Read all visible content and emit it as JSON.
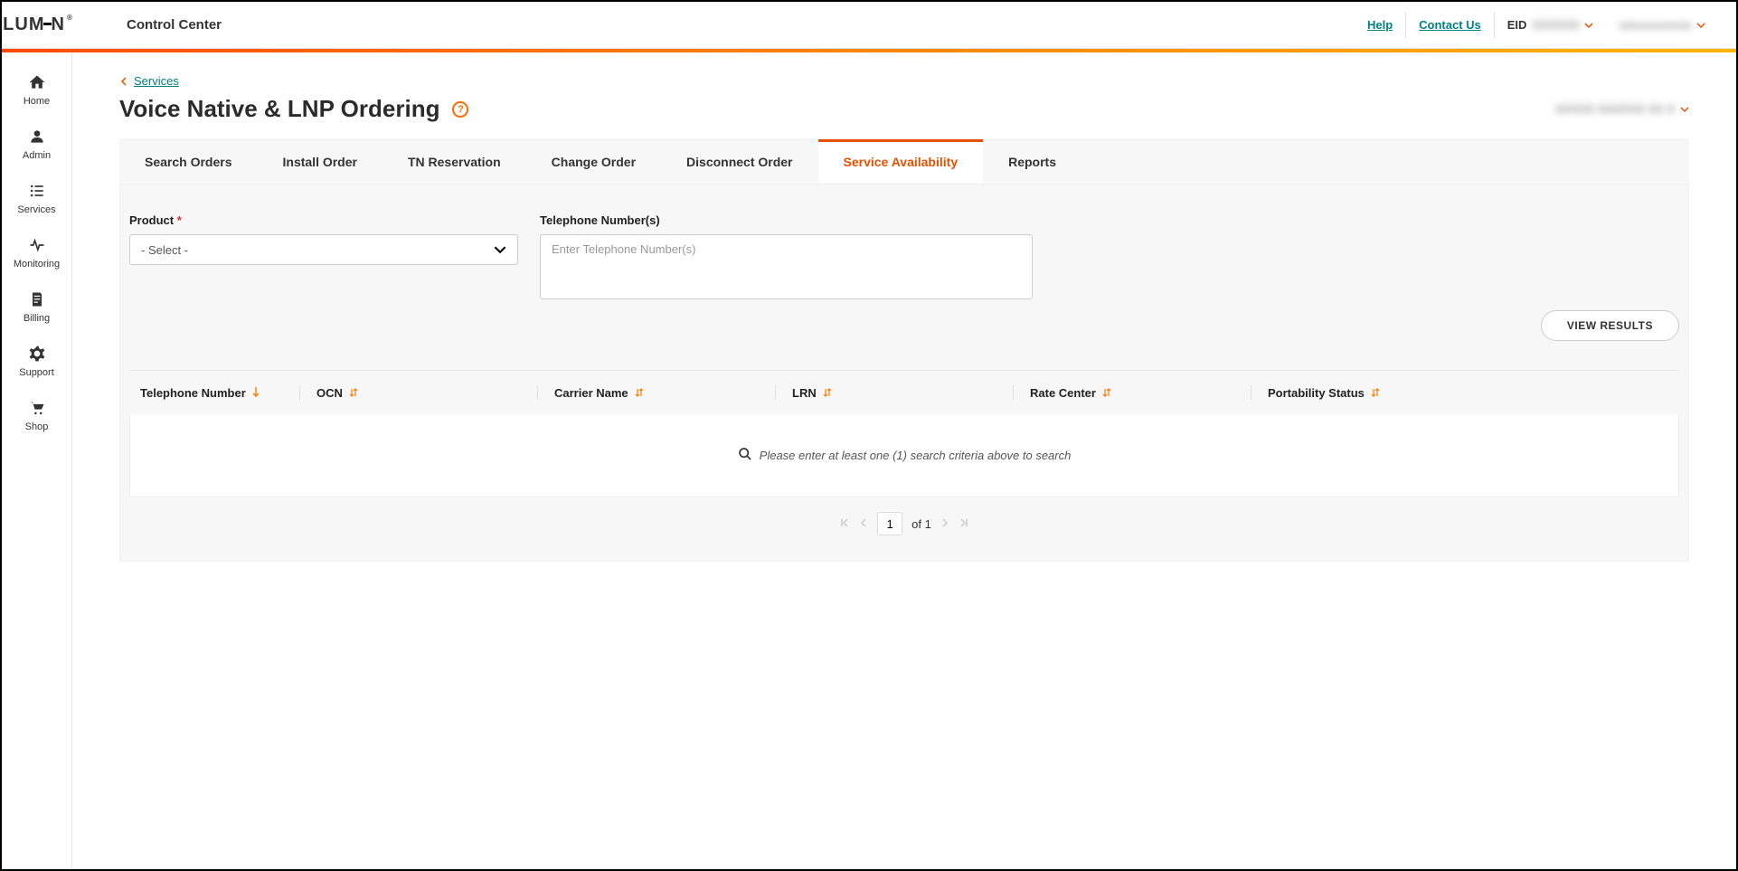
{
  "header": {
    "logo_text_left": "LUM",
    "logo_text_right": "N",
    "app_title": "Control Center",
    "help": "Help",
    "contact": "Contact Us",
    "eid_label": "EID",
    "eid_value": "XXXXXX",
    "user_name": "xxxxxxxxxxx"
  },
  "sidenav": {
    "items": [
      {
        "label": "Home"
      },
      {
        "label": "Admin"
      },
      {
        "label": "Services"
      },
      {
        "label": "Monitoring"
      },
      {
        "label": "Billing"
      },
      {
        "label": "Support"
      },
      {
        "label": "Shop"
      }
    ]
  },
  "breadcrumb": {
    "back": "Services"
  },
  "page": {
    "title": "Voice Native & LNP Ordering",
    "account": "XXXXX XXXXXX XX X"
  },
  "tabs": [
    {
      "label": "Search Orders"
    },
    {
      "label": "Install Order"
    },
    {
      "label": "TN Reservation"
    },
    {
      "label": "Change Order"
    },
    {
      "label": "Disconnect Order"
    },
    {
      "label": "Service Availability"
    },
    {
      "label": "Reports"
    }
  ],
  "form": {
    "product_label": "Product",
    "product_value": "- Select -",
    "tn_label": "Telephone Number(s)",
    "tn_placeholder": "Enter Telephone Number(s)",
    "view_results": "VIEW RESULTS"
  },
  "table": {
    "headers": {
      "tn": "Telephone Number",
      "ocn": "OCN",
      "carrier": "Carrier Name",
      "lrn": "LRN",
      "rate_center": "Rate Center",
      "portability": "Portability Status"
    },
    "empty": "Please enter at least one (1) search criteria above to search"
  },
  "pager": {
    "current": "1",
    "of_label": "of",
    "total": "1"
  }
}
